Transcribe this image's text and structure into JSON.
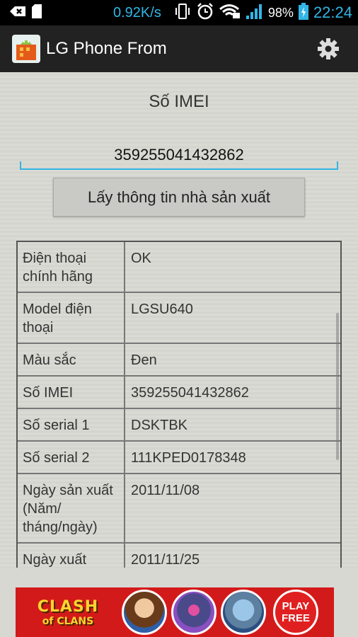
{
  "status_bar": {
    "speed": "0.92K/s",
    "battery": "98%",
    "time": "22:24"
  },
  "action_bar": {
    "title": "LG Phone From",
    "app_icon": "android-app-icon",
    "settings_icon": "gear-icon"
  },
  "form": {
    "imei_label": "Số IMEI",
    "imei_value": "359255041432862",
    "fetch_button": "Lấy thông tin nhà sản xuất"
  },
  "table": {
    "rows": [
      {
        "key": "Điện thoại chính hãng",
        "value": "OK"
      },
      {
        "key": "Model điện thoại",
        "value": "LGSU640"
      },
      {
        "key": "Màu sắc",
        "value": "Đen"
      },
      {
        "key": "Số IMEI",
        "value": "359255041432862"
      },
      {
        "key": "Số serial 1",
        "value": "DSKTBK"
      },
      {
        "key": "Số serial 2",
        "value": "111KPED0178348"
      },
      {
        "key": "Ngày sản xuất (Năm/ tháng/ngày)",
        "value": "2011/11/08"
      },
      {
        "key": "Ngày xuất",
        "value": "2011/11/25"
      }
    ]
  },
  "ad": {
    "brand_line1": "CLASH",
    "brand_line2": "of CLANS",
    "cta_line1": "PLAY",
    "cta_line2": "FREE"
  },
  "colors": {
    "accent": "#33b5e5",
    "action_bar": "#222222",
    "ad_red": "#d31a1a"
  }
}
